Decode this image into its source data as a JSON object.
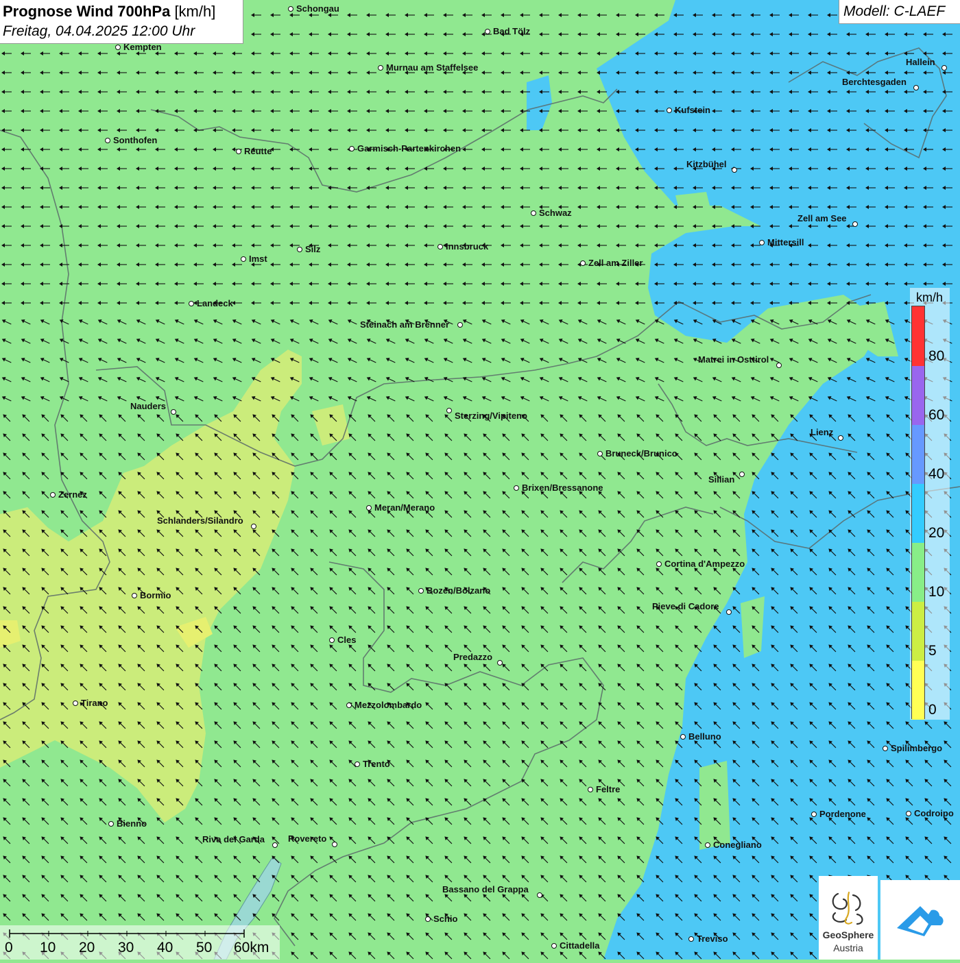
{
  "title": {
    "bold": "Prognose Wind 700hPa",
    "unit": "[km/h]",
    "date": "Freitag, 04.04.2025 12:00 Uhr"
  },
  "model": "Modell: C-LAEF",
  "legend": {
    "unit": "km/h",
    "ticks": [
      "80",
      "60",
      "40",
      "20",
      "10",
      "5",
      "0"
    ],
    "colors": [
      "#ff3333",
      "#9966ee",
      "#6699ff",
      "#33ccff",
      "#88ee88",
      "#ccee44",
      "#ffff55"
    ]
  },
  "scale": {
    "labels": [
      "0",
      "10",
      "20",
      "30",
      "40",
      "50",
      "60km"
    ]
  },
  "logos": {
    "geosphere_line1": "GeoSphere",
    "geosphere_line2": "Austria"
  },
  "field_colors": {
    "green": "#90e890",
    "blue": "#4dc8f5",
    "yellow": "#d6ec78"
  },
  "wind": {
    "north_direction": "from east",
    "south_direction": "from north-east"
  },
  "cities": [
    {
      "name": "Schongau"
    },
    {
      "name": "Bad Tölz"
    },
    {
      "name": "Kempten"
    },
    {
      "name": "Murnau am Staffelsee"
    },
    {
      "name": "Hallein"
    },
    {
      "name": "Berchtesgaden"
    },
    {
      "name": "Kufstein"
    },
    {
      "name": "Sonthofen"
    },
    {
      "name": "Reutte"
    },
    {
      "name": "Garmisch-Partenkirchen"
    },
    {
      "name": "Kitzbühel"
    },
    {
      "name": "Schwaz"
    },
    {
      "name": "Zell am See"
    },
    {
      "name": "Mittersill"
    },
    {
      "name": "Imst"
    },
    {
      "name": "Silz"
    },
    {
      "name": "Innsbruck"
    },
    {
      "name": "Zell am Ziller"
    },
    {
      "name": "Landeck"
    },
    {
      "name": "Steinach am Brenner"
    },
    {
      "name": "Matrei in Osttirol"
    },
    {
      "name": "Nauders"
    },
    {
      "name": "Sterzing/Vipiteno"
    },
    {
      "name": "Lienz"
    },
    {
      "name": "Bruneck/Brunico"
    },
    {
      "name": "Sillian"
    },
    {
      "name": "Brixen/Bressanone"
    },
    {
      "name": "Zernez"
    },
    {
      "name": "Meran/Merano"
    },
    {
      "name": "Schlanders/Silandro"
    },
    {
      "name": "Cortina d'Ampezzo"
    },
    {
      "name": "Bozen/Bolzano"
    },
    {
      "name": "Bormio"
    },
    {
      "name": "Pieve di Cadore"
    },
    {
      "name": "Cles"
    },
    {
      "name": "Predazzo"
    },
    {
      "name": "Tirano"
    },
    {
      "name": "Mezzolombardo"
    },
    {
      "name": "Belluno"
    },
    {
      "name": "Spilimbergo"
    },
    {
      "name": "Trento"
    },
    {
      "name": "Feltre"
    },
    {
      "name": "Pordenone"
    },
    {
      "name": "Codroipo"
    },
    {
      "name": "Bienno"
    },
    {
      "name": "Riva del Garda"
    },
    {
      "name": "Rovereto"
    },
    {
      "name": "Conegliano"
    },
    {
      "name": "Bassano del Grappa"
    },
    {
      "name": "Schio"
    },
    {
      "name": "Treviso"
    },
    {
      "name": "Cittadella"
    }
  ]
}
